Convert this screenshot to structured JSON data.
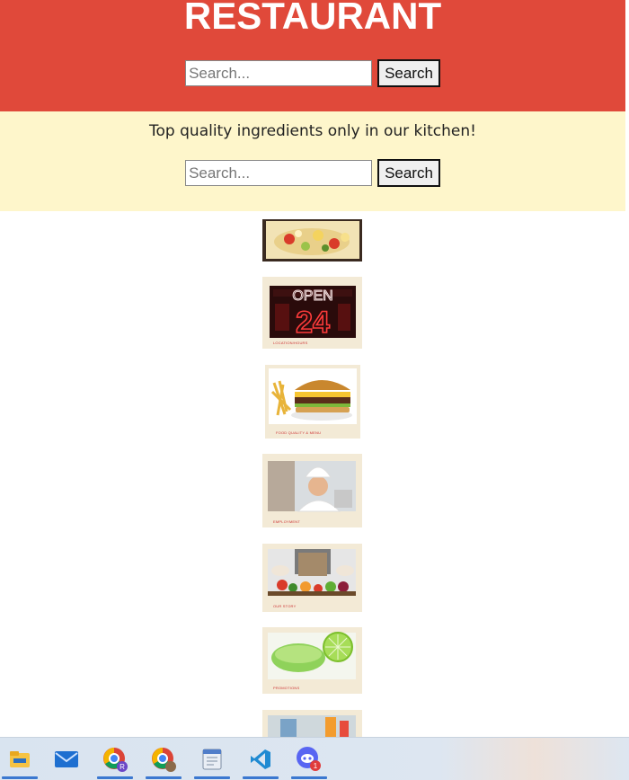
{
  "header": {
    "title": "RESTAURANT",
    "search_placeholder": "Search...",
    "search_button": "Search"
  },
  "banner": {
    "tagline": "Top quality ingredients only in our kitchen!",
    "search_placeholder": "Search...",
    "search_button": "Search"
  },
  "gallery": {
    "items": [
      {
        "name": "salad"
      },
      {
        "name": "open-24",
        "caption": "LOCATION/HOURS"
      },
      {
        "name": "burger",
        "caption": "FOOD QUALITY & MENU"
      },
      {
        "name": "chef",
        "caption": "EMPLOYMENT"
      },
      {
        "name": "vegetables",
        "caption": "OUR STORY"
      },
      {
        "name": "drink",
        "caption": "PROMOTIONS"
      },
      {
        "name": "partial"
      }
    ]
  },
  "taskbar": {
    "apps": [
      "file-explorer",
      "mail",
      "chrome-profile-r",
      "chrome",
      "notepad-editor",
      "vscode",
      "discord"
    ],
    "discord_badge": "1",
    "chrome_profile_badge": "R"
  },
  "colors": {
    "header_bg": "#e0493a",
    "banner_bg": "#fef6cb",
    "taskbar_accent": "#3b78d0"
  }
}
